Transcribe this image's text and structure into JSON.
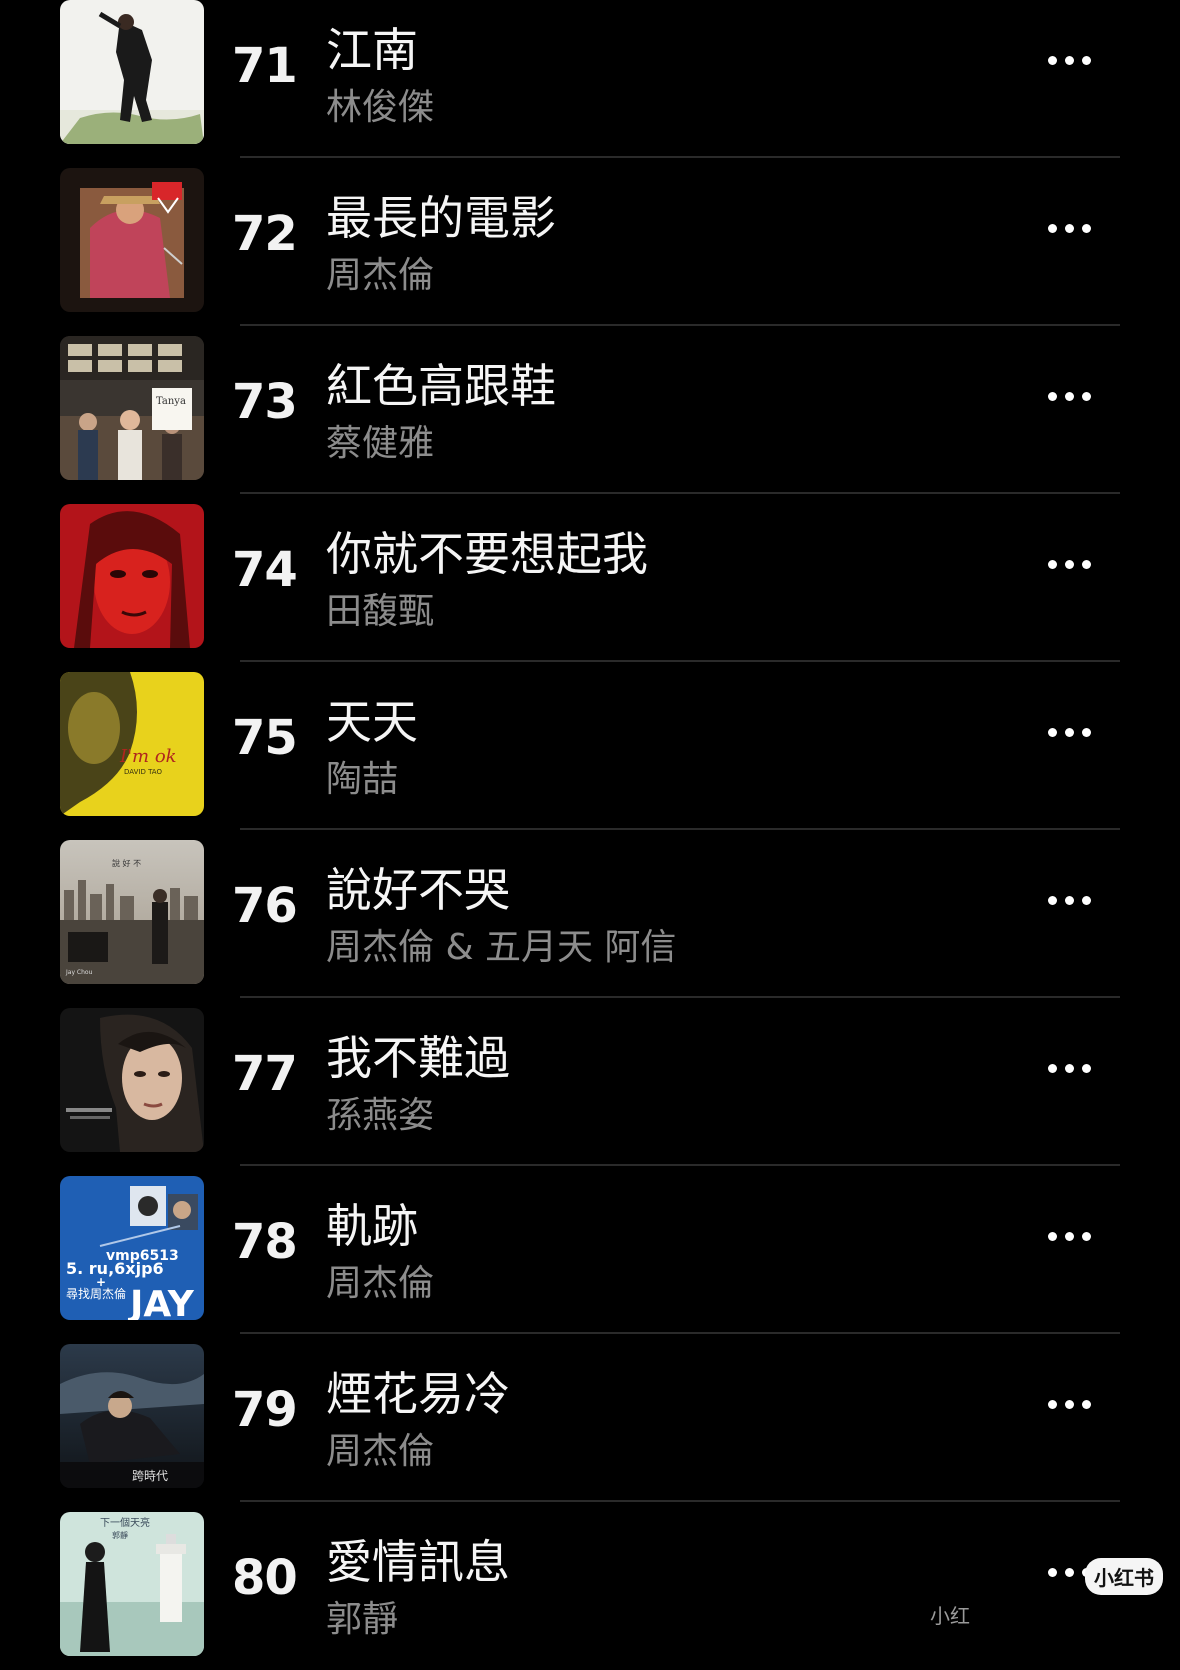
{
  "songs": [
    {
      "rank": "71",
      "title": "江南",
      "artist": "林俊傑"
    },
    {
      "rank": "72",
      "title": "最長的電影",
      "artist": "周杰倫"
    },
    {
      "rank": "73",
      "title": "紅色高跟鞋",
      "artist": "蔡健雅"
    },
    {
      "rank": "74",
      "title": "你就不要想起我",
      "artist": "田馥甄"
    },
    {
      "rank": "75",
      "title": "天天",
      "artist": "陶喆"
    },
    {
      "rank": "76",
      "title": "說好不哭",
      "artist": "周杰倫 & 五月天 阿信"
    },
    {
      "rank": "77",
      "title": "我不難過",
      "artist": "孫燕姿"
    },
    {
      "rank": "78",
      "title": "軌跡",
      "artist": "周杰倫"
    },
    {
      "rank": "79",
      "title": "煙花易冷",
      "artist": "周杰倫"
    },
    {
      "rank": "80",
      "title": "愛情訊息",
      "artist": "郭靜"
    }
  ],
  "watermark": {
    "badge": "小红书",
    "text": "小红"
  },
  "colors": {
    "background": "#000000",
    "title": "#f5f5f5",
    "artist": "#8c8c8c",
    "divider": "#2a2a2a"
  }
}
